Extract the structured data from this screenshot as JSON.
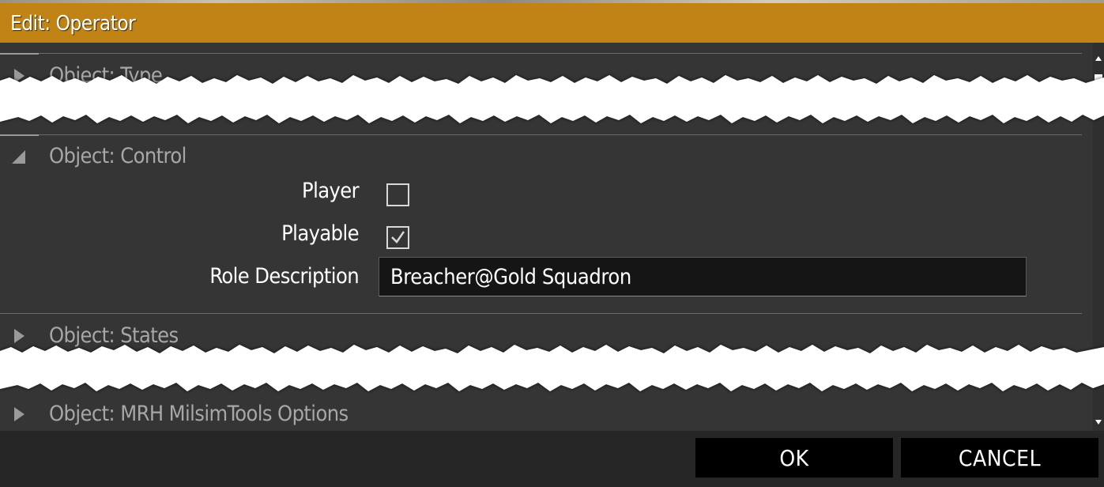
{
  "window": {
    "title": "Edit: Operator"
  },
  "sections": [
    {
      "title": "Object: Type",
      "expanded": false
    },
    {
      "title": "Object: Control",
      "expanded": true
    },
    {
      "title": "Object: States",
      "expanded": false
    },
    {
      "title": "Object: MRH MilsimTools Options",
      "expanded": false
    }
  ],
  "control": {
    "player": {
      "label": "Player",
      "checked": false
    },
    "playable": {
      "label": "Playable",
      "checked": true
    },
    "role_description": {
      "label": "Role Description",
      "value": "Breacher@Gold Squadron"
    }
  },
  "footer": {
    "ok_label": "OK",
    "cancel_label": "CANCEL"
  },
  "colors": {
    "title_bar": "#c18315",
    "panel": "#353535",
    "field": "#151515",
    "button": "#000000"
  }
}
